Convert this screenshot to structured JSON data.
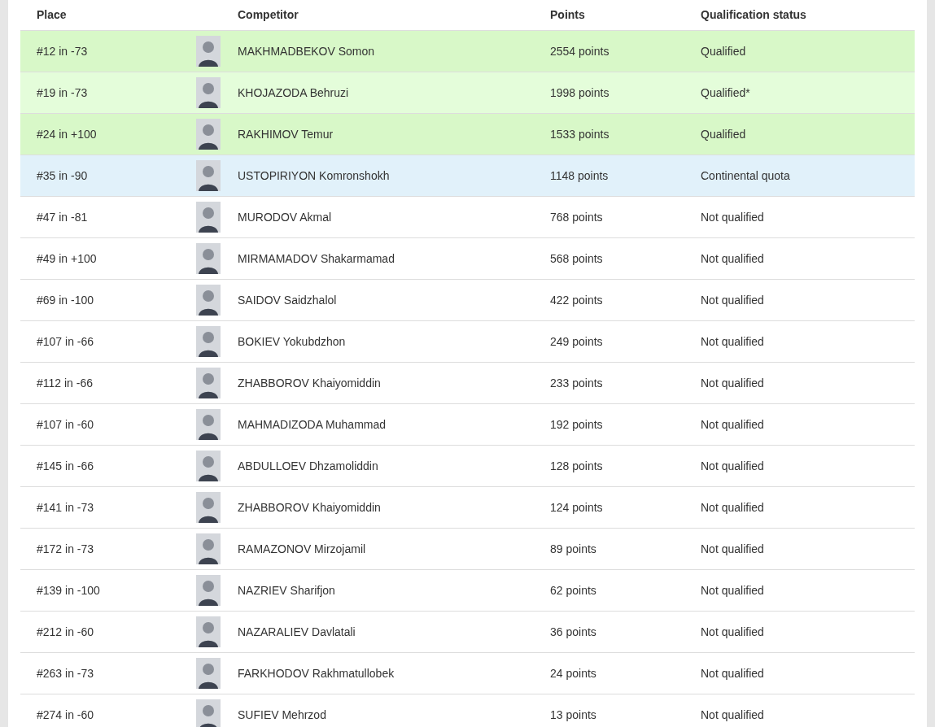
{
  "table": {
    "columns": [
      "Place",
      "Competitor",
      "Points",
      "Qualification status"
    ],
    "rows": [
      {
        "place": "#12 in -73",
        "competitor": "MAKHMADBEKOV Somon",
        "points": "2554 points",
        "status": "Qualified",
        "kind": "qualified"
      },
      {
        "place": "#19 in -73",
        "competitor": "KHOJAZODA Behruzi",
        "points": "1998 points",
        "status": "Qualified*",
        "kind": "qualified"
      },
      {
        "place": "#24 in +100",
        "competitor": "RAKHIMOV Temur",
        "points": "1533 points",
        "status": "Qualified",
        "kind": "qualified"
      },
      {
        "place": "#35 in -90",
        "competitor": "USTOPIRIYON Komronshokh",
        "points": "1148 points",
        "status": "Continental quota",
        "kind": "continental"
      },
      {
        "place": "#47 in -81",
        "competitor": "MURODOV Akmal",
        "points": "768 points",
        "status": "Not qualified",
        "kind": "none"
      },
      {
        "place": "#49 in +100",
        "competitor": "MIRMAMADOV Shakarmamad",
        "points": "568 points",
        "status": "Not qualified",
        "kind": "none"
      },
      {
        "place": "#69 in -100",
        "competitor": "SAIDOV Saidzhalol",
        "points": "422 points",
        "status": "Not qualified",
        "kind": "none"
      },
      {
        "place": "#107 in -66",
        "competitor": "BOKIEV Yokubdzhon",
        "points": "249 points",
        "status": "Not qualified",
        "kind": "none"
      },
      {
        "place": "#112 in -66",
        "competitor": "ZHABBOROV Khaiyomiddin",
        "points": "233 points",
        "status": "Not qualified",
        "kind": "none"
      },
      {
        "place": "#107 in -60",
        "competitor": "MAHMADIZODA Muhammad",
        "points": "192 points",
        "status": "Not qualified",
        "kind": "none"
      },
      {
        "place": "#145 in -66",
        "competitor": "ABDULLOEV Dhzamoliddin",
        "points": "128 points",
        "status": "Not qualified",
        "kind": "none"
      },
      {
        "place": "#141 in -73",
        "competitor": "ZHABBOROV Khaiyomiddin",
        "points": "124 points",
        "status": "Not qualified",
        "kind": "none"
      },
      {
        "place": "#172 in -73",
        "competitor": "RAMAZONOV Mirzojamil",
        "points": "89 points",
        "status": "Not qualified",
        "kind": "none"
      },
      {
        "place": "#139 in -100",
        "competitor": "NAZRIEV Sharifjon",
        "points": "62 points",
        "status": "Not qualified",
        "kind": "none"
      },
      {
        "place": "#212 in -60",
        "competitor": "NAZARALIEV Davlatali",
        "points": "36 points",
        "status": "Not qualified",
        "kind": "none"
      },
      {
        "place": "#263 in -73",
        "competitor": "FARKHODOV Rakhmatullobek",
        "points": "24 points",
        "status": "Not qualified",
        "kind": "none"
      },
      {
        "place": "#274 in -60",
        "competitor": "SUFIEV Mehrzod",
        "points": "13 points",
        "status": "Not qualified",
        "kind": "none"
      }
    ]
  }
}
